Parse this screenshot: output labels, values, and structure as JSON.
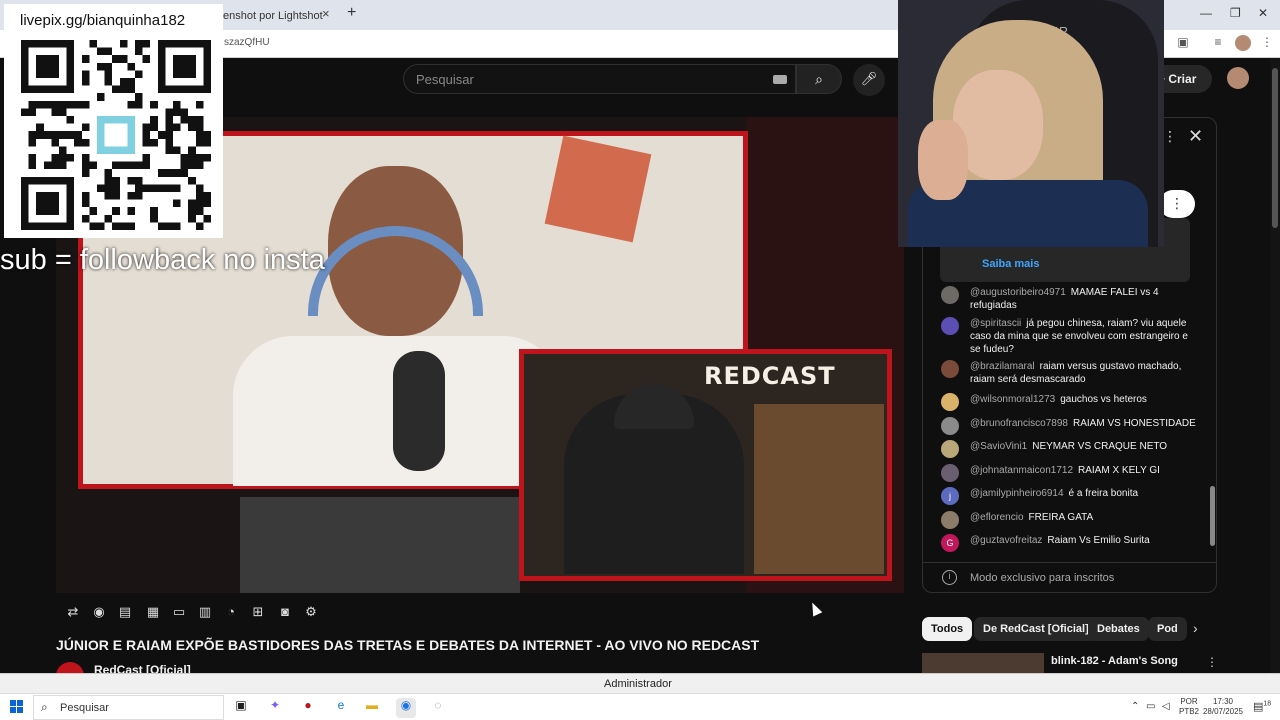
{
  "browser": {
    "tab_title": "enshot por Lightshot",
    "tab_close": "×",
    "new_tab": "+",
    "url_fragment": "szazQfHU",
    "min": "—",
    "max": "❐",
    "close": "✕"
  },
  "youtube": {
    "search_placeholder": "Pesquisar",
    "create_label": "Criar"
  },
  "overlay": {
    "livepix_url": "livepix.gg/bianquinha182",
    "sub_text": "sub = followback no insta",
    "chair_logo": "RACER"
  },
  "video": {
    "inset_logo": "REDCAST",
    "title": "JÚNIOR E RAIAM EXPÕE BASTIDORES DAS TRETAS E DEBATES DA INTERNET - AO VIVO NO REDCAST",
    "channel_name": "RedCast [Oficial]"
  },
  "chat": {
    "pinned_link": "Saiba mais",
    "messages": [
      {
        "author": "@augustoribeiro4971",
        "text": "MAMAE FALEI vs 4 refugiadas",
        "color": "#6d6a66"
      },
      {
        "author": "@spiritascii",
        "text": "já pegou chinesa, raiam? viu aquele caso da mina que se envolveu com estrangeiro e se fudeu?",
        "color": "#5b4fb3"
      },
      {
        "author": "@brazilamaral",
        "text": "raiam versus gustavo machado, raiam será desmascarado",
        "color": "#7a4a3a"
      },
      {
        "author": "@wilsonmoral1273",
        "text": "gauchos vs heteros",
        "color": "#d9b36a"
      },
      {
        "author": "@brunofrancisco7898",
        "text": "RAIAM VS HONESTIDADE",
        "color": "#8a8a8a"
      },
      {
        "author": "@SavioVini1",
        "text": "NEYMAR VS CRAQUE NETO",
        "color": "#b9a77a"
      },
      {
        "author": "@johnatanmaicon1712",
        "text": "RAIAM X KELY GI",
        "color": "#6a5f70"
      },
      {
        "author": "@jamilypinheiro6914",
        "text": "é a freira bonita",
        "color": "#5c6bc0",
        "initial": "j"
      },
      {
        "author": "@eflorencio",
        "text": "FREIRA GATA",
        "color": "#8b7b68"
      },
      {
        "author": "@guztavofreitaz",
        "text": "Raiam Vs Emilio Surita",
        "color": "#c2185b",
        "initial": "G"
      }
    ],
    "footer_text": "Modo exclusivo para inscritos",
    "footer_icon": "i"
  },
  "chips": [
    "Todos",
    "De RedCast [Oficial]",
    "Debates",
    "Pod"
  ],
  "recommendation": {
    "title": "blink-182 - Adam's Song"
  },
  "windows": {
    "admin_label": "Administrador",
    "search_label": "Pesquisar",
    "lang_line1": "POR",
    "lang_line2": "PTB2",
    "time": "17:30",
    "date": "28/07/2025",
    "notif_count": "18"
  },
  "colors": {
    "accent_red": "#c0141c",
    "link_blue": "#3ea6ff"
  }
}
